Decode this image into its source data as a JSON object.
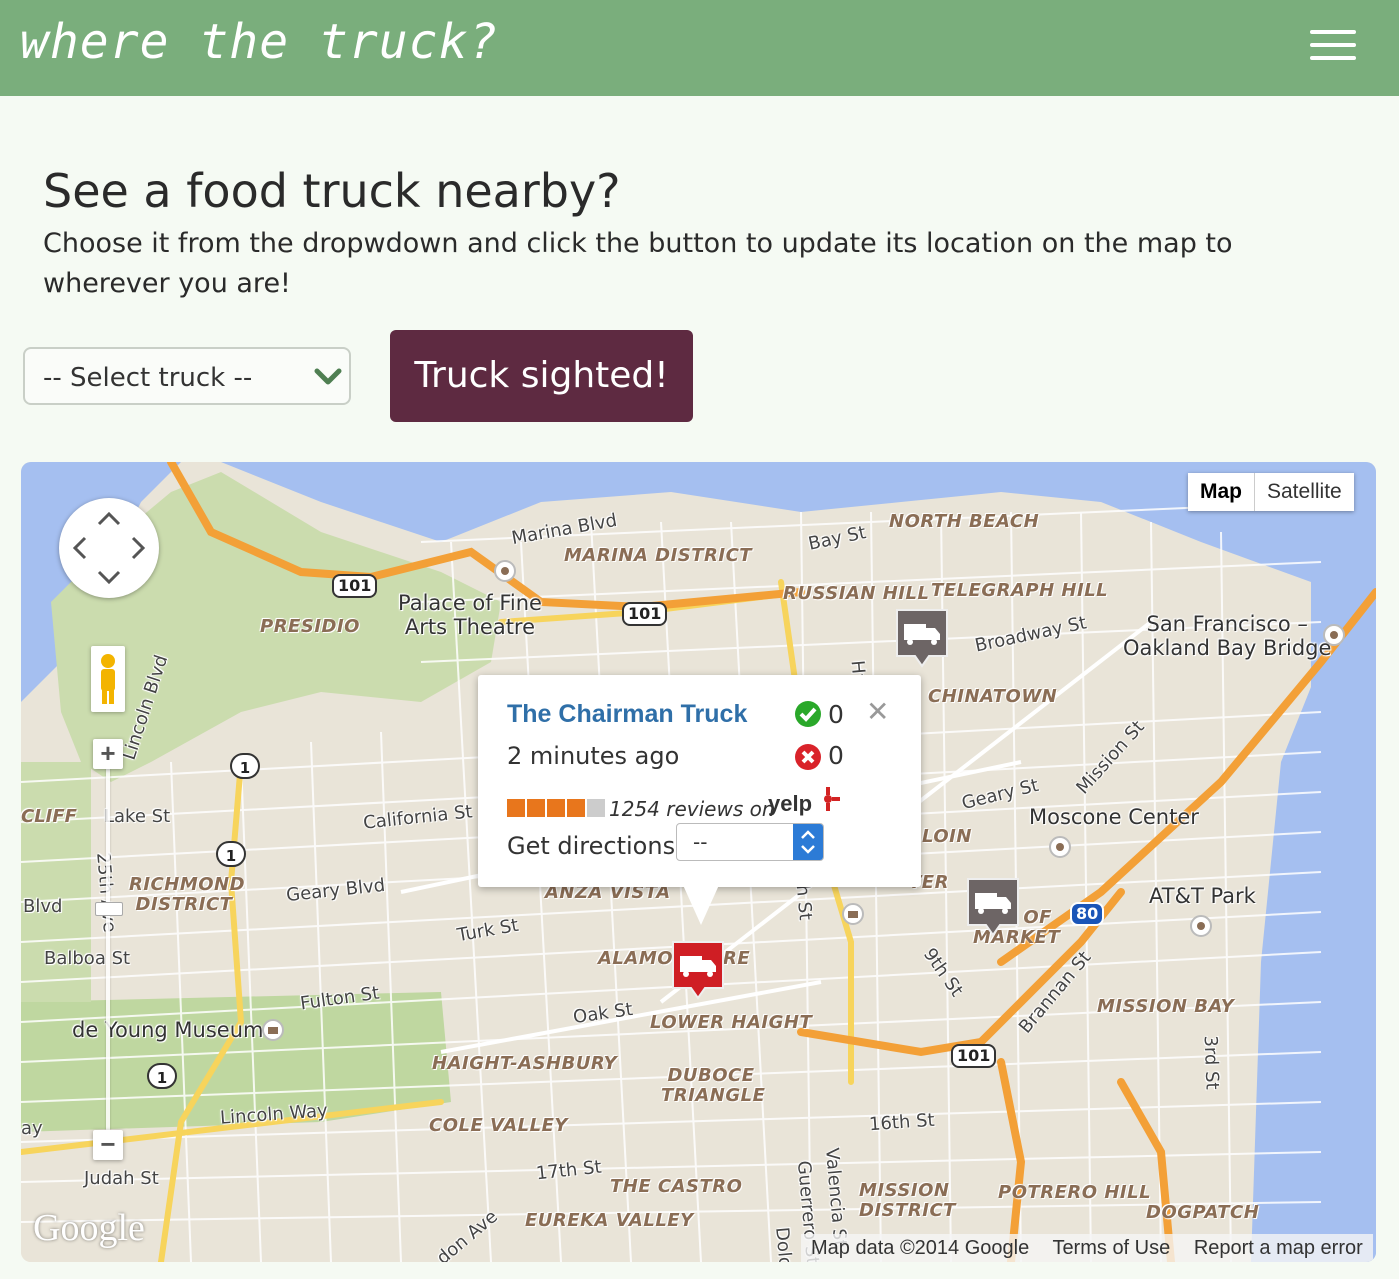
{
  "header": {
    "logo_text": "where the truck?",
    "menu_icon": "hamburger-menu-icon"
  },
  "intro": {
    "heading": "See a food truck nearby?",
    "body": "Choose it from the dropwdown and click the button to update its location on the map to wherever you are!"
  },
  "form": {
    "select_value": "-- Select truck --",
    "button_label": "Truck sighted!",
    "colors": {
      "button": "#5e2a41",
      "header": "#7aae7c"
    }
  },
  "map": {
    "map_type": {
      "map": "Map",
      "satellite": "Satellite"
    },
    "street_labels": [
      "Marina Blvd",
      "Bay St",
      "Broadway St",
      "Lincoln Blvd",
      "Lake St",
      "California St",
      "Geary St",
      "Mission St",
      "Geary Blvd",
      "Turk St",
      "25th Ave",
      "Balboa St",
      "Fulton St",
      "Oak St",
      "Lincoln Way",
      "Judah St",
      "17th St",
      "16th St",
      "9th St",
      "Brannan St",
      "3rd St",
      "Guerrero St",
      "Valencia St",
      "Blvd",
      "ay",
      "CLIFF",
      "Hy",
      "Dolo",
      "don Ave",
      "h St"
    ],
    "districts": [
      "MARINA DISTRICT",
      "NORTH BEACH",
      "RUSSIAN HILL",
      "TELEGRAPH HILL",
      "PRESIDIO",
      "CHINATOWN",
      "RICHMOND DISTRICT",
      "ANZA VISTA",
      "ALAMO",
      "RE",
      "LOWER HAIGHT",
      "HAIGHT-ASHBURY",
      "DUBOCE TRIANGLE",
      "COLE VALLEY",
      "THE CASTRO",
      "EUREKA VALLEY",
      "MISSION DISTRICT",
      "POTRERO HILL",
      "DOGPATCH",
      "MISSION BAY",
      "LOIN",
      "H OF",
      "MARKET",
      "TER"
    ],
    "pois": {
      "palace": "Palace of Fine\nArts Theatre",
      "bay_bridge": "San Francisco –\nOakland Bay Bridge",
      "moscone": "Moscone Center",
      "att_park": "AT&T Park",
      "de_young": "de Young Museum"
    },
    "shields": {
      "us101": "101",
      "ca1": "1",
      "i80": "80"
    },
    "info_window": {
      "truck_name": "The Chairman Truck",
      "time_ago": "2 minutes ago",
      "upvotes": "0",
      "downvotes": "0",
      "reviews_text": "1254 reviews on",
      "yelp_label": "yelp",
      "rating_stars": 4,
      "directions_label": "Get directions:",
      "directions_value": "--"
    },
    "attribution": {
      "google": "Google",
      "data": "Map data ©2014 Google",
      "terms": "Terms of Use",
      "report": "Report a map error"
    }
  }
}
